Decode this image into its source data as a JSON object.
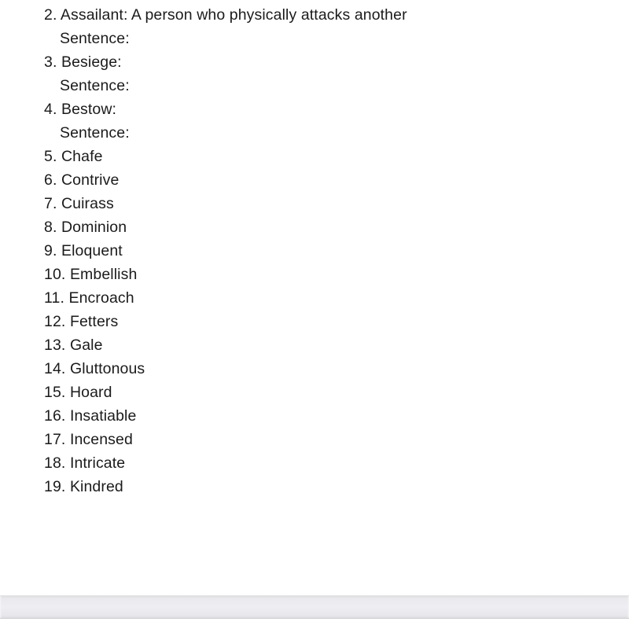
{
  "document": {
    "lines": [
      {
        "kind": "vocab",
        "number": "2.",
        "text": "Assailant: A person who physically attacks another"
      },
      {
        "kind": "sentence",
        "text": "Sentence:"
      },
      {
        "kind": "vocab",
        "number": "3.",
        "text": "Besiege:"
      },
      {
        "kind": "sentence",
        "text": "Sentence:"
      },
      {
        "kind": "vocab",
        "number": "4.",
        "text": "Bestow:"
      },
      {
        "kind": "sentence",
        "text": "Sentence:"
      },
      {
        "kind": "vocab",
        "number": "5.",
        "text": "Chafe"
      },
      {
        "kind": "vocab",
        "number": "6.",
        "text": "Contrive"
      },
      {
        "kind": "vocab",
        "number": "7.",
        "text": "Cuirass"
      },
      {
        "kind": "vocab",
        "number": "8.",
        "text": "Dominion"
      },
      {
        "kind": "vocab",
        "number": "9.",
        "text": "Eloquent"
      },
      {
        "kind": "vocab",
        "number": "10.",
        "text": "Embellish"
      },
      {
        "kind": "vocab",
        "number": "11.",
        "text": "Encroach"
      },
      {
        "kind": "vocab",
        "number": "12.",
        "text": "Fetters"
      },
      {
        "kind": "vocab",
        "number": "13.",
        "text": "Gale"
      },
      {
        "kind": "vocab",
        "number": "14.",
        "text": "Gluttonous"
      },
      {
        "kind": "vocab",
        "number": "15.",
        "text": "Hoard"
      },
      {
        "kind": "vocab",
        "number": "16.",
        "text": "Insatiable"
      },
      {
        "kind": "vocab",
        "number": "17.",
        "text": "Incensed"
      },
      {
        "kind": "vocab",
        "number": "18.",
        "text": "Intricate"
      },
      {
        "kind": "vocab",
        "number": "19.",
        "text": "Kindred"
      }
    ]
  },
  "colors": {
    "page_background": "#ffffff",
    "text": "#1b1b1b",
    "bottom_bar_top": "#e9e9ee",
    "bottom_bar_bottom": "#d4d4d8"
  }
}
